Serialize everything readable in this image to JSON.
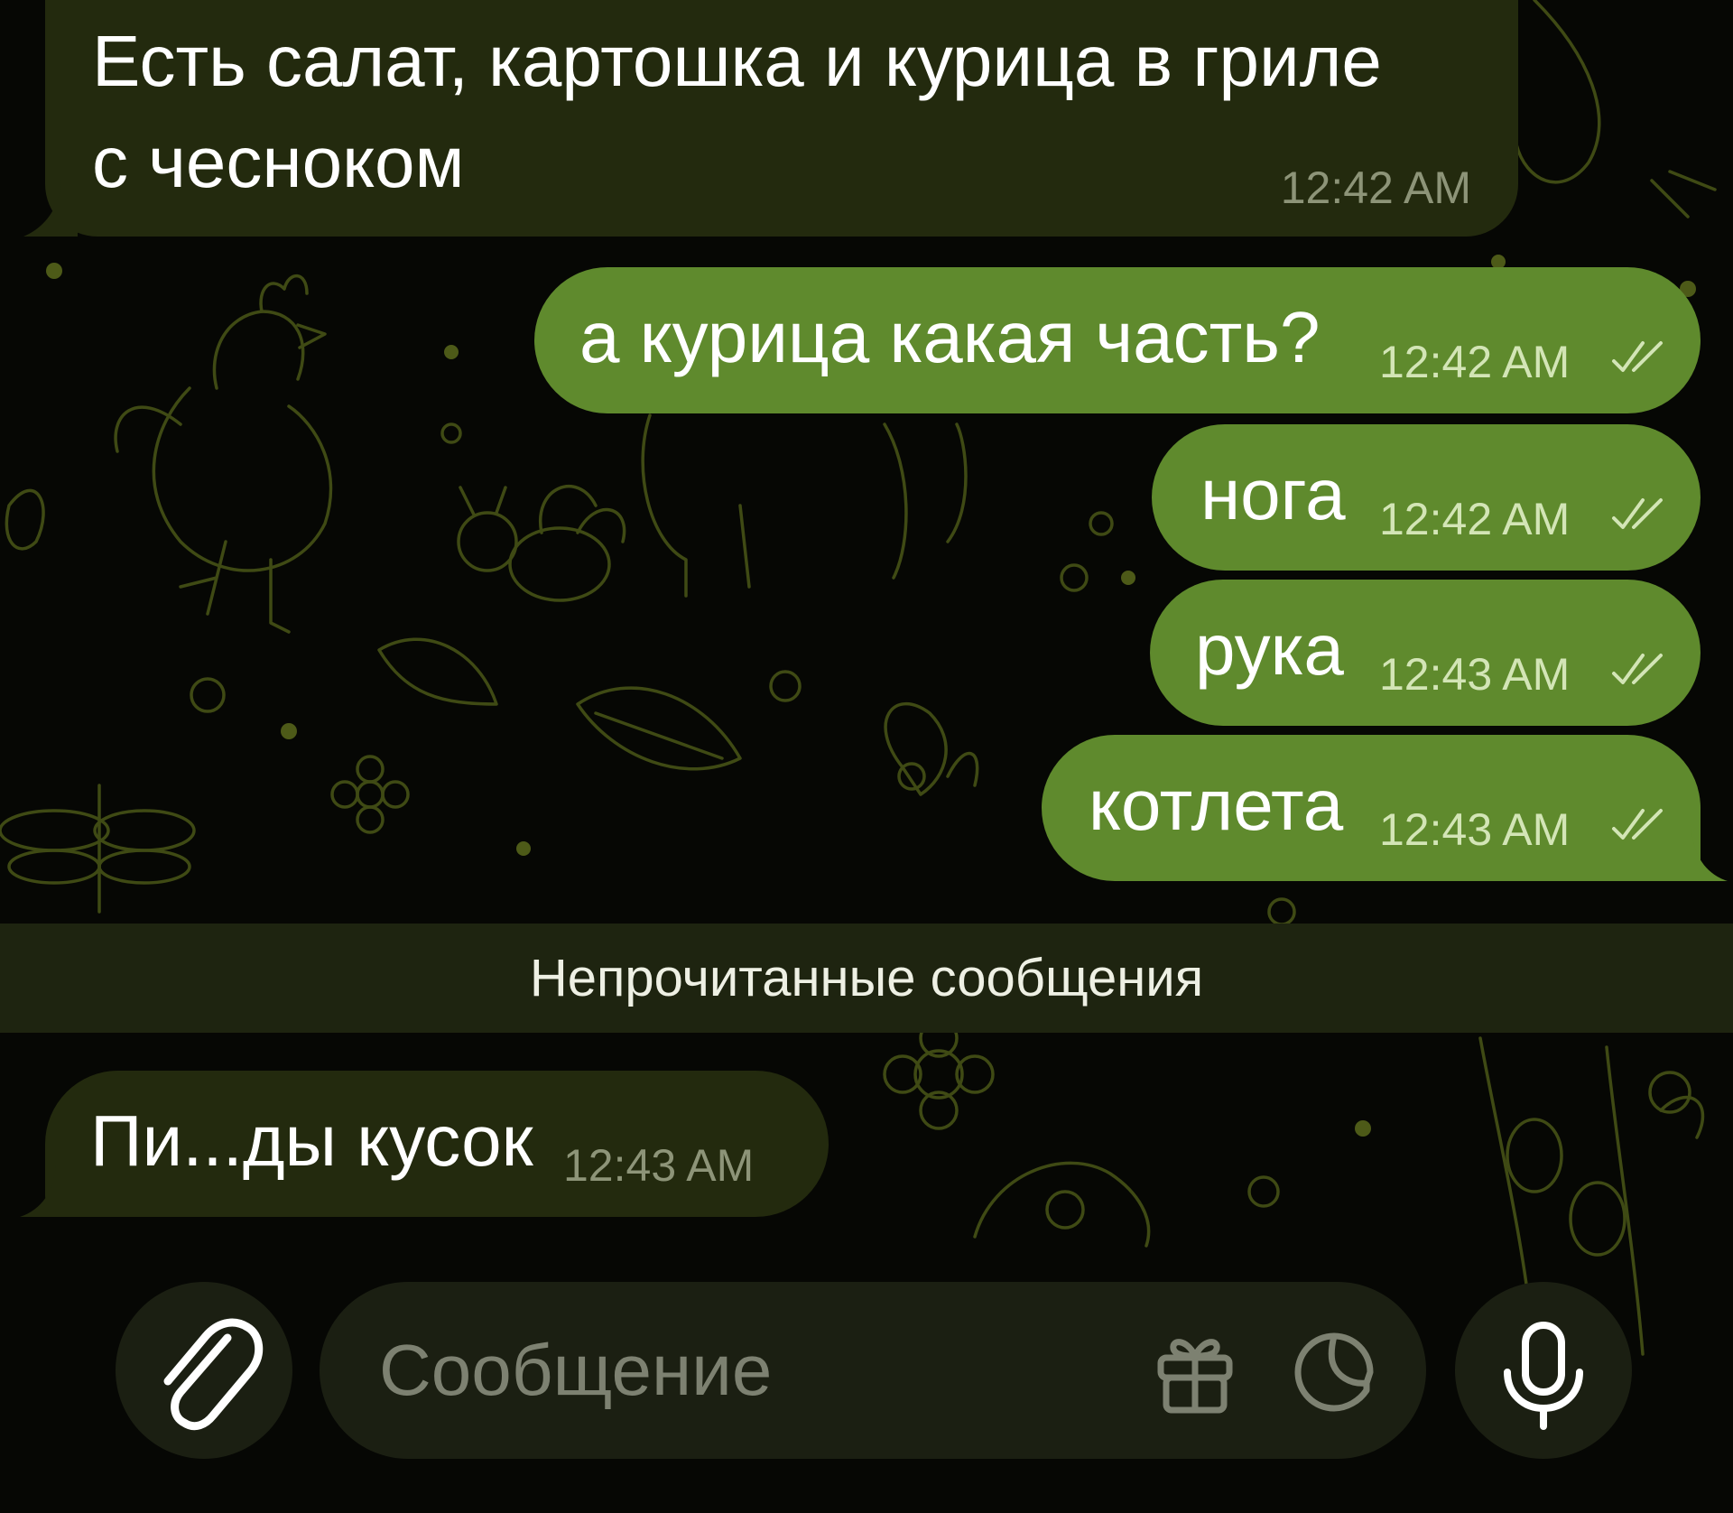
{
  "messages": [
    {
      "direction": "incoming",
      "text_lines": [
        "Есть салат, картошка и курица в гриле",
        "с чесноком"
      ],
      "time": "12:42 AM"
    },
    {
      "direction": "outgoing",
      "text": "а курица какая часть?",
      "time": "12:42 AM",
      "status": "read"
    },
    {
      "direction": "outgoing",
      "text": "нога",
      "time": "12:42 AM",
      "status": "read"
    },
    {
      "direction": "outgoing",
      "text": "рука",
      "time": "12:43 AM",
      "status": "read"
    },
    {
      "direction": "outgoing",
      "text": "котлета",
      "time": "12:43 AM",
      "status": "read"
    },
    {
      "direction": "incoming",
      "text": "Пи...ды кусок",
      "time": "12:43 AM"
    }
  ],
  "unread_divider": {
    "label": "Непрочитанные сообщения"
  },
  "composer": {
    "placeholder": "Сообщение",
    "attach_icon": "paperclip-icon",
    "gift_icon": "gift-icon",
    "sticker_icon": "sticker-icon",
    "voice_icon": "microphone-icon"
  },
  "colors": {
    "background": "#060704",
    "incoming_bubble": "#232a0e",
    "outgoing_bubble": "#5f8a2d",
    "divider_bar": "#1e2410",
    "doodle": "#3f4a14"
  }
}
